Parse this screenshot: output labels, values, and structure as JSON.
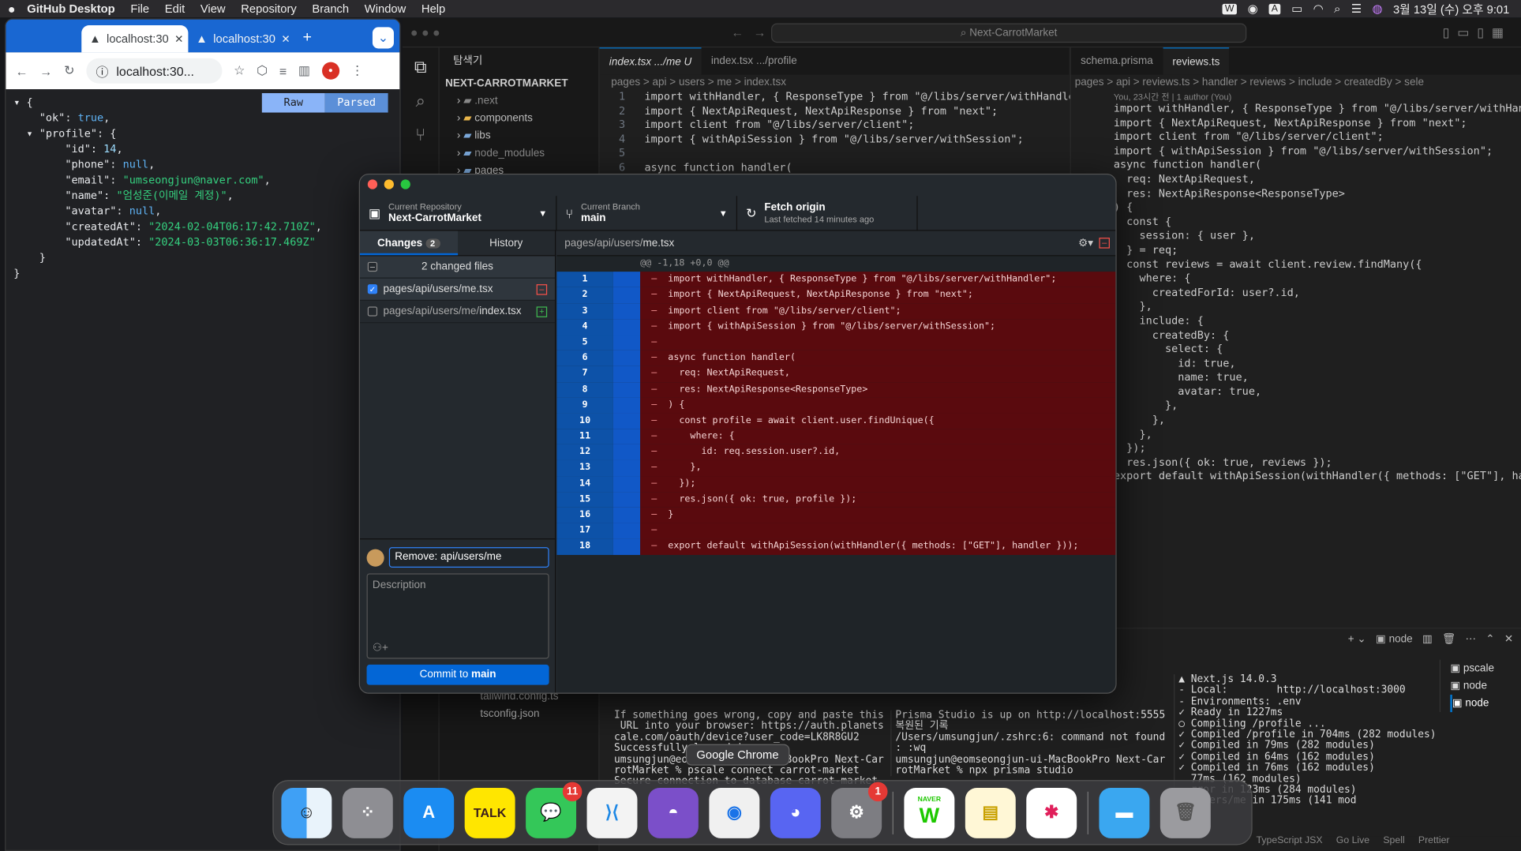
{
  "menubar": {
    "app": "GitHub Desktop",
    "items": [
      "File",
      "Edit",
      "View",
      "Repository",
      "Branch",
      "Window",
      "Help"
    ],
    "clock": "3월 13일 (수) 오후 9:01"
  },
  "chrome": {
    "tabs": [
      {
        "title": "localhost:30"
      },
      {
        "title": "localhost:30"
      }
    ],
    "url": "localhost:30...",
    "raw_label": "Raw",
    "parsed_label": "Parsed",
    "json_lines": [
      {
        "t": "▾ {"
      },
      {
        "t": "    \"ok\": ",
        "v": "true",
        "c": "b",
        "e": ","
      },
      {
        "t": "  ▾ \"profile\": {"
      },
      {
        "t": "        \"id\": ",
        "v": "14",
        "c": "n",
        "e": ","
      },
      {
        "t": "        \"phone\": ",
        "v": "null",
        "c": "b",
        "e": ","
      },
      {
        "t": "        \"email\": ",
        "v": "\"umseongjun@naver.com\"",
        "c": "s",
        "e": ","
      },
      {
        "t": "        \"name\": ",
        "v": "\"엄성준(이메일 계정)\"",
        "c": "s",
        "e": ","
      },
      {
        "t": "        \"avatar\": ",
        "v": "null",
        "c": "b",
        "e": ","
      },
      {
        "t": "        \"createdAt\": ",
        "v": "\"2024-02-04T06:17:42.710Z\"",
        "c": "s",
        "e": ","
      },
      {
        "t": "        \"updatedAt\": ",
        "v": "\"2024-03-03T06:36:17.469Z\"",
        "c": "s",
        "e": ""
      },
      {
        "t": "    }"
      },
      {
        "t": "}"
      }
    ]
  },
  "vscode": {
    "search": "Next-CarrotMarket",
    "explorer_title": "탐색기",
    "project": "NEXT-CARROTMARKET",
    "tree": [
      ".next",
      "components",
      "libs",
      "node_modules",
      "pages"
    ],
    "tree_bottom": [
      "tailwind.config.ts",
      "tsconfig.json"
    ],
    "tabs_left": [
      {
        "label": "index.tsx .../me U",
        "active": true
      },
      {
        "label": "index.tsx .../profile",
        "active": false
      }
    ],
    "breadcrumb_left": "pages  >  api  >  users  >  me  >  index.tsx",
    "tabs_right": [
      {
        "label": "schema.prisma",
        "active": false
      },
      {
        "label": "reviews.ts",
        "active": true
      }
    ],
    "breadcrumb_right": "pages > api > reviews.ts > handler > reviews > include > createdBy > sele",
    "blame": "You, 23시간 전 | 1 author (You)",
    "left_code": [
      "import withHandler, { ResponseType } from \"@/libs/server/withHandler\";",
      "import { NextApiRequest, NextApiResponse } from \"next\";",
      "import client from \"@/libs/server/client\";",
      "import { withApiSession } from \"@/libs/server/withSession\";",
      "",
      "async function handler("
    ],
    "right_code": [
      "import withHandler, { ResponseType } from \"@/libs/server/withHandler\";",
      "import { NextApiRequest, NextApiResponse } from \"next\";",
      "import client from \"@/libs/server/client\";",
      "import { withApiSession } from \"@/libs/server/withSession\";",
      "",
      "async function handler(",
      "  req: NextApiRequest,",
      "  res: NextApiResponse<ResponseType>",
      ") {",
      "  const {",
      "    session: { user },",
      "  } = req;",
      "  const reviews = await client.review.findMany({",
      "    where: {",
      "      createdForId: user?.id,",
      "    },",
      "    include: {",
      "      createdBy: {",
      "        select: {",
      "          id: true,",
      "          name: true,",
      "          avatar: true,",
      "        },",
      "      },",
      "    },",
      "  });",
      "",
      "  res.json({ ok: true, reviews });",
      "",
      "export default withApiSession(withHandler({ methods: [\"GET\"], handler }));"
    ],
    "terminal_panels": {
      "left": [
        "If something goes wrong, copy and paste this",
        " URL into your browser: https://auth.planets",
        "cale.com/oauth/device?user_code=LK8R8GU2",
        "",
        "Successfully logged in.",
        "umsungjun@eomseongjun-ui-MacBookPro Next-Car",
        "rotMarket % pscale connect carrot-market",
        "Secure connection to database carrot-market"
      ],
      "middle": [
        "Prisma Studio is up on http://localhost:5555",
        "",
        "복원된 기록",
        "",
        "/Users/umsungjun/.zshrc:6: command not found",
        ": :wq",
        "umsungjun@eomseongjun-ui-MacBookPro Next-Car",
        "rotMarket % npx prisma studio"
      ],
      "right": [
        "▲ Next.js 14.0.3",
        "- Local:        http://localhost:3000",
        "- Environments: .env",
        "",
        "✓ Ready in 1227ms",
        "○ Compiling /profile ...",
        "✓ Compiled /profile in 704ms (282 modules)",
        "✓ Compiled in 79ms (282 modules)",
        "✓ Compiled in 64ms (162 modules)",
        "✓ Compiled in 76ms (162 modules)",
        "  77ms (162 modules)",
        "  rror in 123ms (284 modules)",
        "  /users/me in 175ms (141 mod"
      ],
      "shell_label": "node",
      "shells": [
        "pscale",
        "node",
        "node"
      ]
    },
    "statusbar": [
      "TypeScript JSX",
      "Go Live",
      "Spell",
      "Prettier"
    ]
  },
  "github": {
    "repo_label": "Current Repository",
    "repo": "Next-CarrotMarket",
    "branch_label": "Current Branch",
    "branch": "main",
    "fetch": "Fetch origin",
    "fetch_sub": "Last fetched 14 minutes ago",
    "tab_changes": "Changes",
    "changes_count": "2",
    "tab_history": "History",
    "changed_files": "2 changed files",
    "files": [
      {
        "path_dim": "pages/api/users/",
        "path_bold": "me.tsx",
        "checked": true,
        "kind": "removed"
      },
      {
        "path_dim": "pages/api/users/me/",
        "path_bold": "index.tsx",
        "checked": false,
        "kind": "added"
      }
    ],
    "diff_path_dim": "pages/api/users/",
    "diff_path_bold": "me.tsx",
    "hunk": "@@ -1,18 +0,0 @@",
    "diff": [
      "import withHandler, { ResponseType } from \"@/libs/server/withHandler\";",
      "import { NextApiRequest, NextApiResponse } from \"next\";",
      "import client from \"@/libs/server/client\";",
      "import { withApiSession } from \"@/libs/server/withSession\";",
      "",
      "async function handler(",
      "  req: NextApiRequest,",
      "  res: NextApiResponse<ResponseType>",
      ") {",
      "  const profile = await client.user.findUnique({",
      "    where: {",
      "      id: req.session.user?.id,",
      "    },",
      "  });",
      "  res.json({ ok: true, profile });",
      "}",
      "",
      "export default withApiSession(withHandler({ methods: [\"GET\"], handler }));"
    ],
    "summary": "Remove: api/users/me",
    "description_placeholder": "Description",
    "commit_prefix": "Commit to ",
    "commit_branch": "main"
  },
  "dock": {
    "tooltip": "Google Chrome",
    "messages_badge": "11",
    "settings_badge": "1",
    "talk": "TALK",
    "naver": "NAVER"
  }
}
